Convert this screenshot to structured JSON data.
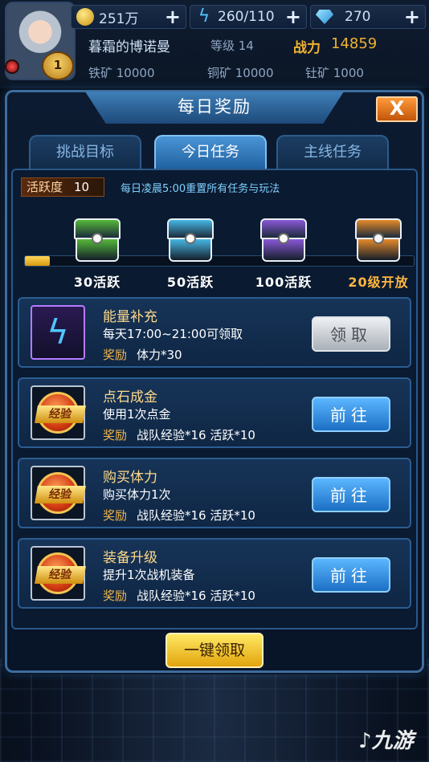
{
  "hud": {
    "gold": "251万",
    "energy": "260/110",
    "gems": "270",
    "player_name": "暮霜的博诺曼",
    "level": "等级 14",
    "power_label": "战力",
    "power": "14859",
    "avatar_level": "1",
    "iron": "铁矿 10000",
    "copper": "铜矿 10000",
    "thorium": "钍矿 1000"
  },
  "dialog": {
    "title": "每日奖励",
    "close": "X",
    "tabs": [
      {
        "label": "挑战目标",
        "active": false
      },
      {
        "label": "今日任务",
        "active": true
      },
      {
        "label": "主线任务",
        "active": false
      }
    ],
    "activity_label": "活跃度",
    "activity_value": "10",
    "reset_note": "每日凌晨5:00重置所有任务与玩法",
    "progress_fraction": 0.065,
    "chests": [
      {
        "label": "30活跃",
        "color": "#55b83a"
      },
      {
        "label": "50活跃",
        "color": "#46b8e6"
      },
      {
        "label": "100活跃",
        "color": "#8a58d8"
      },
      {
        "label": "20级开放",
        "color": "#e58a2a"
      }
    ],
    "tasks": [
      {
        "title": "能量补充",
        "desc": "每天17:00~21:00可领取",
        "reward_label": "奖励",
        "reward": "体力*30",
        "button": "领取",
        "icon": "lightning-bolt-icon"
      },
      {
        "title": "点石成金",
        "desc": "使用1次点金",
        "reward_label": "奖励",
        "reward": "战队经验*16  活跃*10",
        "button": "前往",
        "icon": "exp-medal-icon",
        "medal_text": "经验"
      },
      {
        "title": "购买体力",
        "desc": "购买体力1次",
        "reward_label": "奖励",
        "reward": "战队经验*16  活跃*10",
        "button": "前往",
        "icon": "exp-medal-icon",
        "medal_text": "经验"
      },
      {
        "title": "装备升级",
        "desc": "提升1次战机装备",
        "reward_label": "奖励",
        "reward": "战队经验*16  活跃*10",
        "button": "前往",
        "icon": "exp-medal-icon",
        "medal_text": "经验"
      }
    ],
    "one_key_claim": "一键领取"
  },
  "watermark": "九游"
}
